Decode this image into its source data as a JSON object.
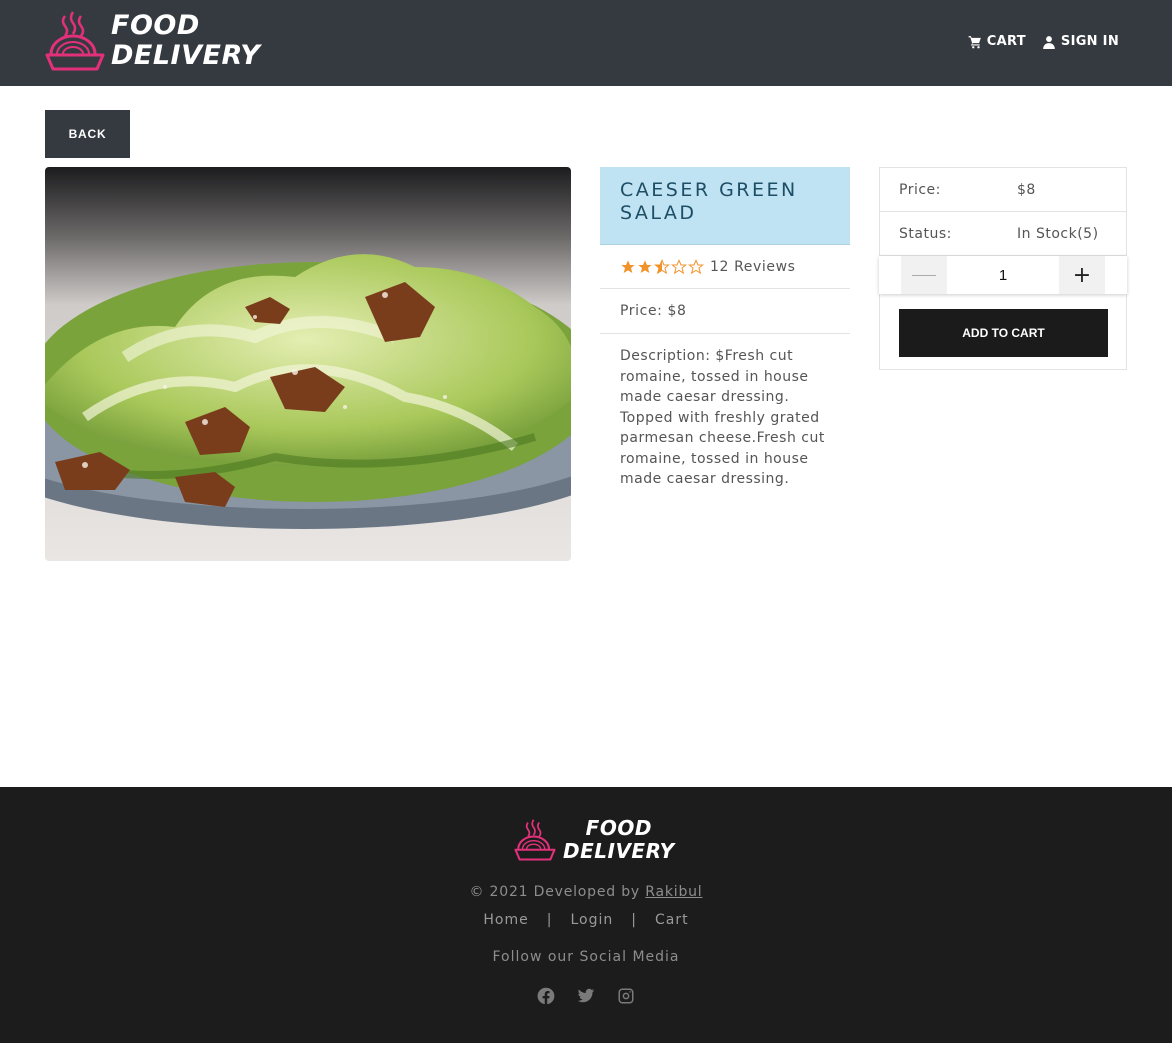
{
  "header": {
    "brand_line1": "FOOD",
    "brand_line2": "DELIVERY",
    "nav": {
      "cart": "CART",
      "sign_in": "SIGN IN"
    }
  },
  "back_label": "BACK",
  "product": {
    "title": "CAESER GREEN SALAD",
    "rating": 2.5,
    "reviews": "12 Reviews",
    "price_line": "Price: $8",
    "description": "Description: $Fresh cut romaine, tossed in house made caesar dressing. Topped with freshly grated parmesan cheese.Fresh cut romaine, tossed in house made caesar dressing."
  },
  "cart_card": {
    "price_label": "Price:",
    "price_value": "$8",
    "status_label": "Status:",
    "status_value": "In Stock(5)",
    "quantity": "1",
    "minus": "",
    "plus": "+",
    "add_to_cart": "ADD TO CART"
  },
  "footer": {
    "brand_line1": "FOOD",
    "brand_line2": "DELIVERY",
    "copyright": "© 2021 Developed by ",
    "developer": "Rakibul",
    "links": {
      "home": "Home",
      "login": "Login",
      "cart": "Cart",
      "separator": "|"
    },
    "follow": "Follow our Social Media",
    "social_icons": [
      "facebook-icon",
      "twitter-icon",
      "instagram-icon"
    ]
  },
  "colors": {
    "navbar": "#343a40",
    "title_bg": "#bfe3f2",
    "title_text": "#1e4e66",
    "star": "#f0932b",
    "logo_pink": "#e2307a",
    "footer_bg": "#1c1c1c"
  }
}
